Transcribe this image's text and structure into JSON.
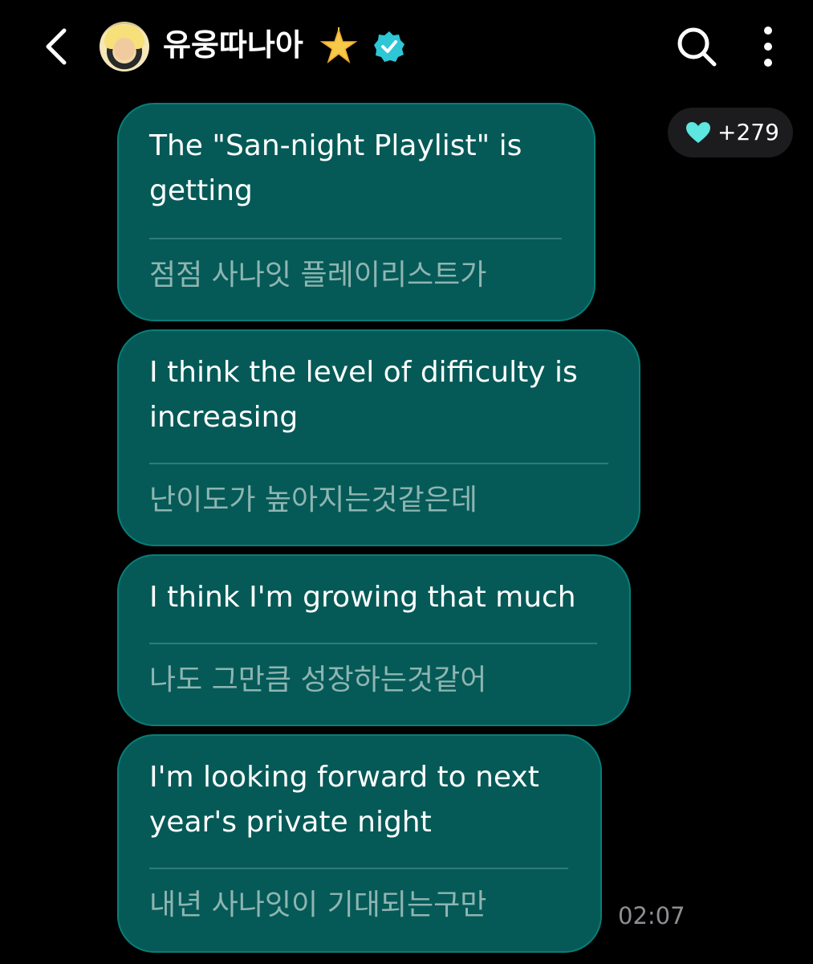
{
  "header": {
    "title": "유웅따나아",
    "icons": {
      "back": "chevron-left-icon",
      "star": "glowing-star-icon",
      "verified": "verified-badge-icon",
      "search": "search-icon",
      "more": "more-vertical-icon"
    },
    "accent": "#2fc6d6"
  },
  "reaction": {
    "icon": "heart-icon",
    "count": "+279",
    "color": "#5ee6e0"
  },
  "messages": [
    {
      "en_line1": "The \"San-night Playlist\" is",
      "en_line2": "getting",
      "ko": "점점 사나잇 플레이리스트가"
    },
    {
      "en_line1": "I think the level of difficulty is",
      "en_line2": "increasing",
      "ko": "난이도가 높아지는것같은데"
    },
    {
      "en_line1": "I think I'm growing that much",
      "en_line2": "",
      "ko": "나도 그만큼 성장하는것같어"
    },
    {
      "en_line1": "I'm looking forward to next",
      "en_line2": "year's private night",
      "ko": "내년 사나잇이 기대되는구만"
    }
  ],
  "timestamp": "02:07",
  "colors": {
    "bubble": "#055a57",
    "bubble_border": "#0a7d77",
    "translation_text": "#8fb5b2",
    "background": "#000000"
  }
}
